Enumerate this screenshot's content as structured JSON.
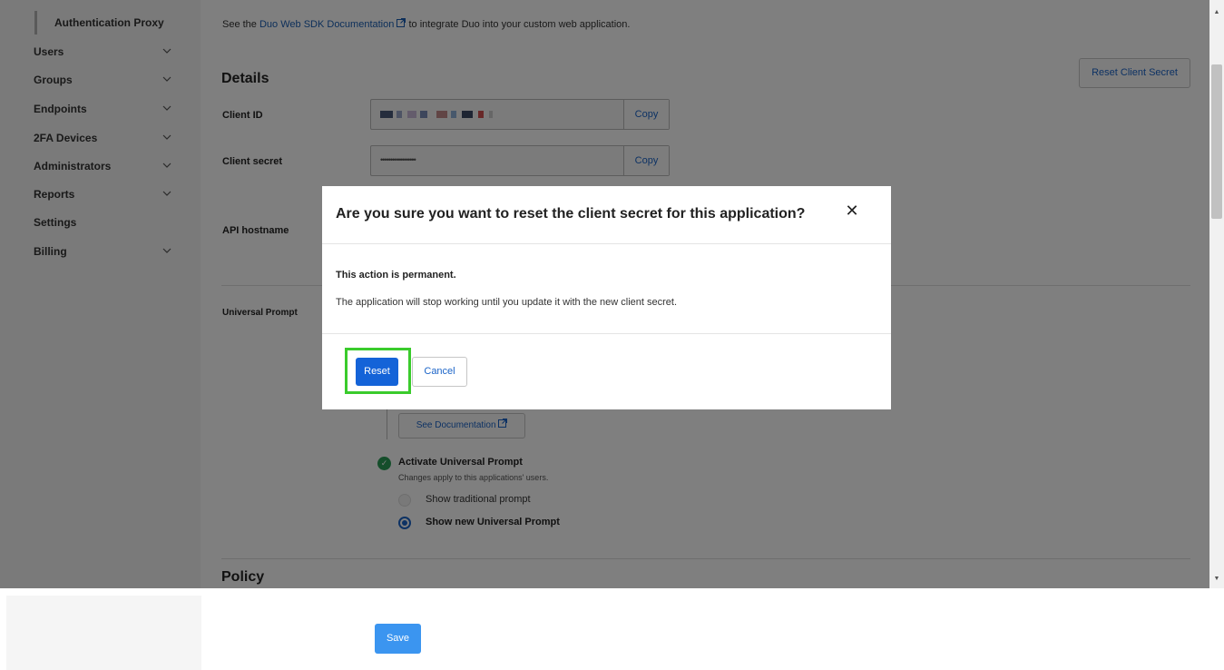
{
  "sidebar": {
    "sub_item": "Authentication Proxy",
    "items": [
      {
        "label": "Users",
        "icon": "chevron-down-icon"
      },
      {
        "label": "Groups",
        "icon": "chevron-down-icon"
      },
      {
        "label": "Endpoints",
        "icon": "chevron-down-icon"
      },
      {
        "label": "2FA Devices",
        "icon": "chevron-down-icon"
      },
      {
        "label": "Administrators",
        "icon": "chevron-down-icon"
      },
      {
        "label": "Reports",
        "icon": "chevron-down-icon"
      },
      {
        "label": "Settings"
      },
      {
        "label": "Billing",
        "icon": "chevron-down-icon"
      }
    ]
  },
  "main": {
    "intro_prefix": "See the ",
    "intro_link": "Duo Web SDK Documentation",
    "intro_suffix": " to integrate Duo into your custom web application.",
    "details_heading": "Details",
    "reset_client_secret": "Reset Client Secret",
    "client_id_label": "Client ID",
    "client_secret_label": "Client secret",
    "client_secret_value": "••••••••••••••••••",
    "copy_label": "Copy",
    "api_hostname_label": "API hostname",
    "universal_prompt_label": "Universal Prompt",
    "see_documentation": "See Documentation",
    "activate_title": "Activate Universal Prompt",
    "activate_subtitle": "Changes apply to this applications' users.",
    "option_traditional": "Show traditional prompt",
    "option_new": "Show new Universal Prompt",
    "selected_option": "Show new Universal Prompt",
    "policy_heading": "Policy"
  },
  "modal": {
    "title": "Are you sure you want to reset the client secret for this application?",
    "close_icon": "close-icon",
    "bold_text": "This action is permanent.",
    "body_text": "The application will stop working until you update it with the new client secret.",
    "reset_label": "Reset",
    "cancel_label": "Cancel"
  },
  "footer": {
    "save_label": "Save"
  },
  "colors": {
    "accent": "#1463d8",
    "highlight": "#3acb2c",
    "success": "#2a9d57"
  }
}
